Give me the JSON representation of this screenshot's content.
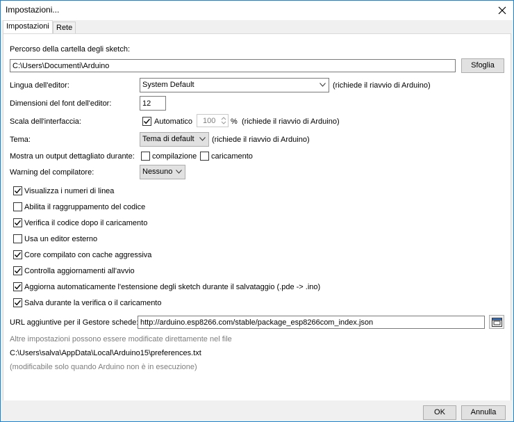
{
  "window": {
    "title": "Impostazioni..."
  },
  "tabs": [
    {
      "label": "Impostazioni",
      "active": true
    },
    {
      "label": "Rete",
      "active": false
    }
  ],
  "sketchbook": {
    "label": "Percorso della cartella degli sketch:",
    "value": "C:\\Users\\Documenti\\Arduino",
    "browse_label": "Sfoglia"
  },
  "editor_language": {
    "label": "Lingua dell'editor:",
    "value": "System Default",
    "note": "(richiede il riavvio di Arduino)"
  },
  "font_size": {
    "label": "Dimensioni del font dell'editor:",
    "value": "12"
  },
  "interface_scale": {
    "label": "Scala dell'interfaccia:",
    "auto_label": "Automatico",
    "auto_checked": true,
    "value": "100",
    "unit": "%",
    "note": "(richiede il riavvio di Arduino)"
  },
  "theme": {
    "label": "Tema:",
    "value": "Tema di default",
    "note": "(richiede il riavvio di Arduino)"
  },
  "verbose": {
    "label": "Mostra un output dettagliato durante:",
    "compile_label": "compilazione",
    "compile_checked": false,
    "upload_label": "caricamento",
    "upload_checked": false
  },
  "warnings": {
    "label": "Warning del compilatore:",
    "value": "Nessuno"
  },
  "options": [
    {
      "label": "Visualizza i numeri di linea",
      "checked": true
    },
    {
      "label": "Abilita il raggruppamento del codice",
      "checked": false
    },
    {
      "label": "Verifica il codice dopo il caricamento",
      "checked": true
    },
    {
      "label": "Usa un editor esterno",
      "checked": false
    },
    {
      "label": "Core compilato con cache aggressiva",
      "checked": true
    },
    {
      "label": "Controlla aggiornamenti all'avvio",
      "checked": true
    },
    {
      "label": "Aggiorna automaticamente l'estensione degli sketch durante il salvataggio (.pde -> .ino)",
      "checked": true
    },
    {
      "label": "Salva durante la verifica o il caricamento",
      "checked": true
    }
  ],
  "boards_url": {
    "label": "URL aggiuntive per il Gestore schede:",
    "value": "http://arduino.esp8266.com/stable/package_esp8266com_index.json"
  },
  "info": {
    "line1": "Altre impostazioni possono essere modificate direttamente nel file",
    "path": "C:\\Users\\salva\\AppData\\Local\\Arduino15\\preferences.txt",
    "line3": "(modificabile solo quando Arduino non è in esecuzione)"
  },
  "footer": {
    "ok_label": "OK",
    "cancel_label": "Annulla"
  },
  "colors": {
    "accent": "#1883d7",
    "panel": "#ffffff",
    "chrome": "#f0f0f0"
  }
}
